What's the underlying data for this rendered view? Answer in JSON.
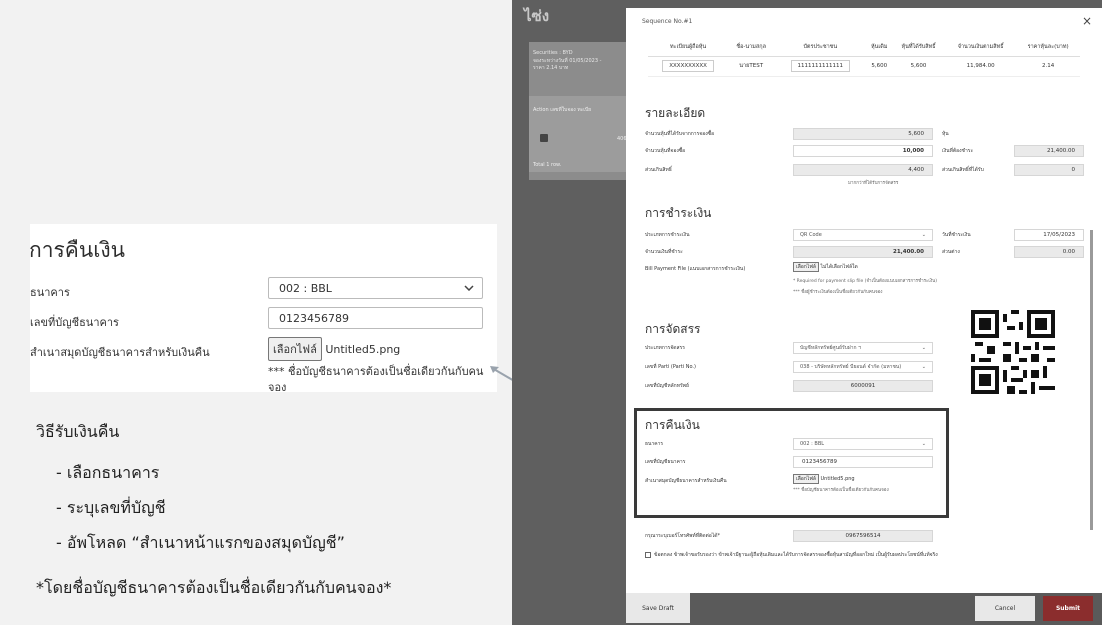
{
  "refund_callout": {
    "title": "การคืนเงิน",
    "bank_label": "ธนาคาร",
    "bank_value": "002 : BBL",
    "account_label": "เลขที่บัญชีธนาคาร",
    "account_value": "0123456789",
    "passbook_label": "สำเนาสมุดบัญชีธนาคารสำหรับเงินคืน",
    "file_button": "เลือกไฟล์",
    "file_name": "Untitled5.png",
    "file_note": "*** ชื่อบัญชีธนาคารต้องเป็นชื่อเดียวกันกับคนจอง"
  },
  "instructions": {
    "title": "วิธีรับเงินคืน",
    "items": [
      "เลือกธนาคาร",
      "ระบุเลขที่บัญชี",
      "อัพโหลด “สำเนาหน้าแรกของสมุดบัญชี”"
    ],
    "note": "*โดยชื่อบัญชีธนาคารต้องเป็นชื่อเดียวกันกับคนจอง*"
  },
  "background_app": {
    "logo": "ไซ่ง",
    "securities_text": "Securities : BYD",
    "booking_text": "จองระหว่างวันที่ 01/05/2023 -",
    "price_text": "ราคา 2.14 บาท",
    "table_header": "Action เลขที่ใบจอง ทะเบีย",
    "row_number": "406-",
    "total": "Total 1 row."
  },
  "modal": {
    "title": "Sequence No.#1",
    "close": "×",
    "table": {
      "headers": [
        "ทะเบียนผู้ถือหุ้น",
        "ชื่อ-นามสกุล",
        "บัตรประชาชน",
        "หุ้นเดิม",
        "หุ้นที่ได้รับสิทธิ์",
        "จำนวนเงินตามสิทธิ์",
        "ราคาหุ้นละ(บาท)"
      ],
      "row": [
        "XXXXXXXXXX",
        "นายTEST",
        "1111111111111",
        "5,600",
        "5,600",
        "11,984.00",
        "2.14"
      ]
    },
    "details": {
      "title": "รายละเอียด",
      "entitled_label": "จำนวนหุ้นที่ได้รับจากการจองซื้อ",
      "entitled_value": "5,600",
      "share_unit": "หุ้น",
      "wanted_label": "จำนวนหุ้นที่จองซื้อ",
      "wanted_value": "10,000",
      "pay_label": "เงินที่ต้องชำระ",
      "pay_value": "21,400.00",
      "excess_label": "ส่วนเกินสิทธิ์",
      "excess_value": "4,400",
      "excess_note": "มากกว่าที่ได้รับการจัดสรร",
      "excess_recv_label": "ส่วนเกินสิทธิ์ที่ได้รับ",
      "excess_recv_value": "0"
    },
    "payment": {
      "title": "การชำระเงิน",
      "method_label": "ประเภทการชำระเงิน",
      "method_value": "QR Code",
      "date_label": "วันที่ชำระเงิน",
      "date_value": "17/05/2023",
      "amount_label": "จำนวนเงินที่ชำระ",
      "amount_value": "21,400.00",
      "diff_label": "ส่วนต่าง",
      "diff_value": "0.00",
      "bill_label": "Bill Payment File (แนบเอกสารการชำระเงิน)",
      "file_button": "เลือกไฟล์",
      "file_none": "ไม่ได้เลือกไฟล์ใด",
      "note1": "* Required for payment slip file (จำเป็นต้องแนบเอกสารการชำระเงิน)",
      "note2": "*** ชื่อผู้ชำระเงินต้องเป็นชื่อเดียวกันกับคนจอง"
    },
    "allocation": {
      "title": "การจัดสรร",
      "type_label": "ประเภทการจัดสรร",
      "type_value": "บัญชีหลักทรัพย์ศูนย์รับฝาก ฯ",
      "broker_label": "เลขที่ Parti (Parti No.)",
      "broker_value": "038 - บริษัทหลักทรัพย์ บียอนด์ จำกัด (มหาชน)",
      "acct_label": "เลขที่บัญชีหลักทรัพย์",
      "acct_value": "6000091"
    },
    "refund": {
      "title": "การคืนเงิน",
      "bank_label": "ธนาคาร",
      "bank_value": "002 : BBL",
      "account_label": "เลขที่บัญชีธนาคาร",
      "account_value": "0123456789",
      "passbook_label": "สำเนาสมุดบัญชีธนาคารสำหรับเงินคืน",
      "file_button": "เลือกไฟล์",
      "file_name": "Untitled5.png",
      "file_note": "*** ชื่อบัญชีธนาคารต้องเป็นชื่อเดียวกันกับคนจอง"
    },
    "phone_label": "กรุณาระบุเบอร์โทรศัพท์ที่ติดต่อได้*",
    "phone_value": "0967596514",
    "consent_text": "ข้อตกลง ข้าพเจ้าขอรับรองว่า ข้าพเจ้ามีฐานะผู้ถือหุ้นเดิมและได้รับการจัดสรรจองซื้อหุ้นสามัญที่ออกใหม่ เป็นผู้รับผลประโยชน์ที่แท้จริง",
    "buttons": {
      "save_draft": "Save Draft",
      "cancel": "Cancel",
      "submit": "Submit"
    }
  }
}
